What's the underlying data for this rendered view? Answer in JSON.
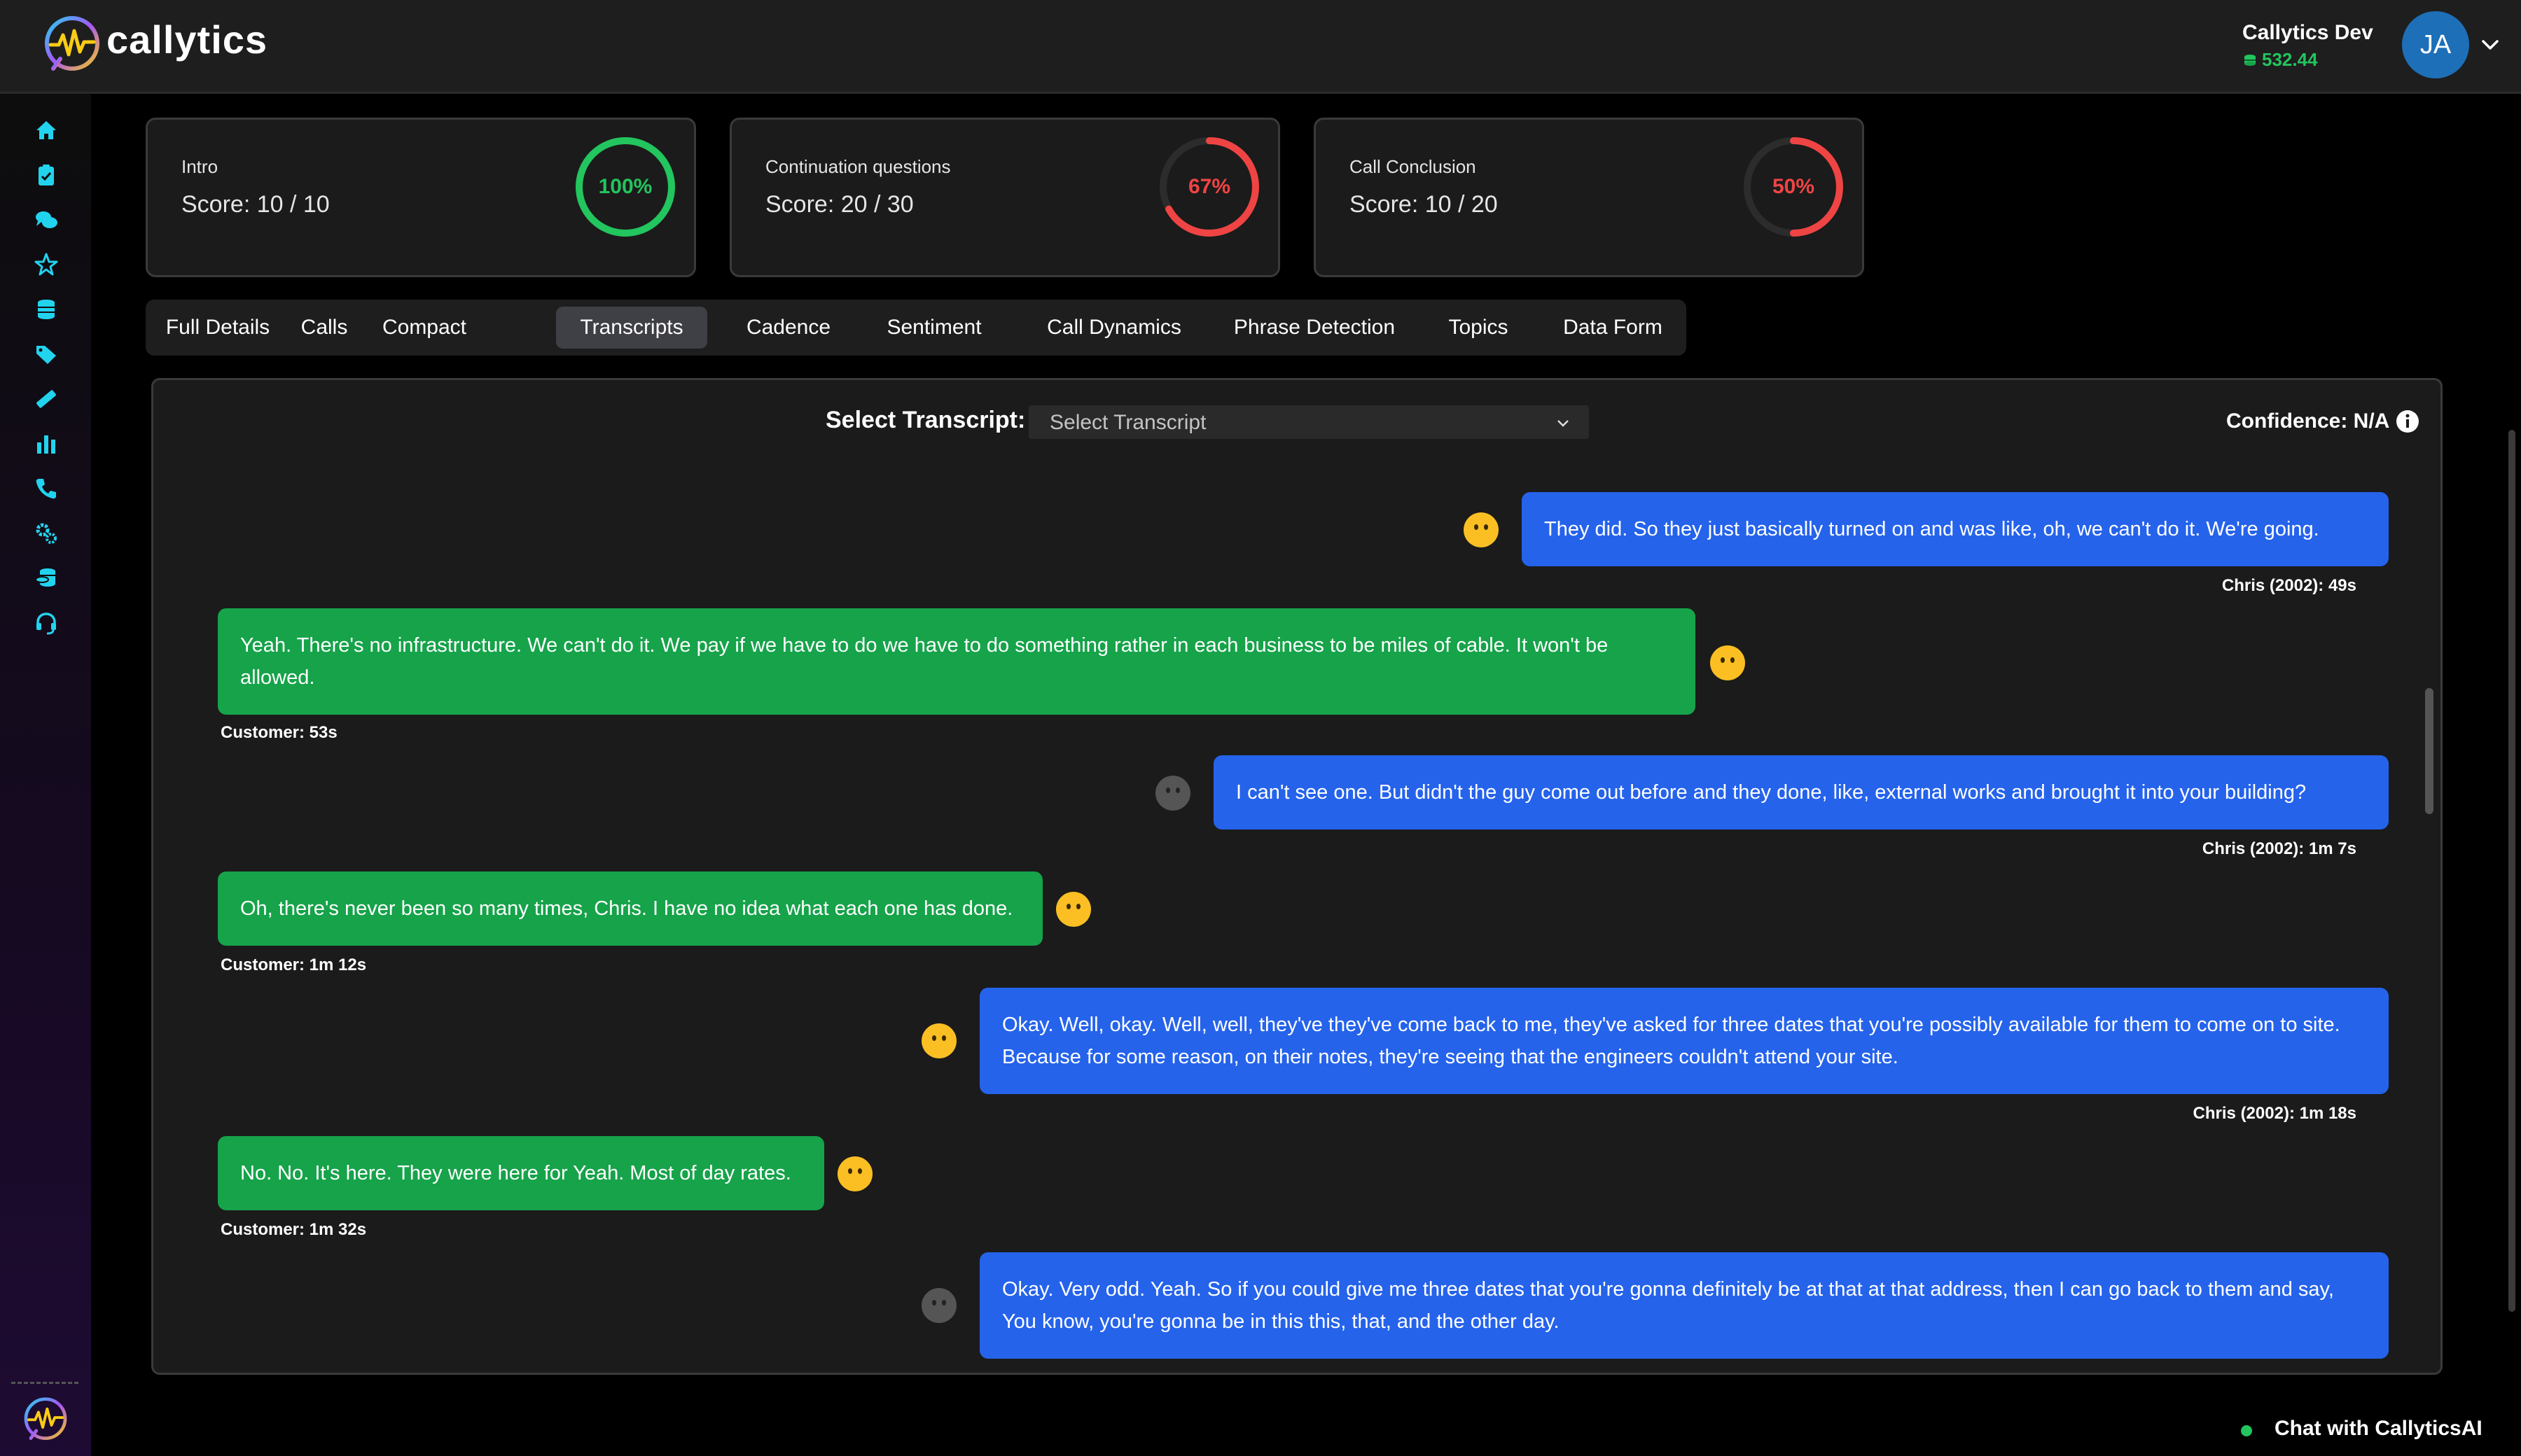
{
  "header": {
    "brand": "callytics",
    "user_name": "Callytics Dev",
    "credits": "532.44",
    "avatar_initials": "JA"
  },
  "sidebar": {
    "icons": [
      "home-icon",
      "clipboard-check-icon",
      "chat-bubbles-icon",
      "star-icon",
      "database-icon",
      "tags-icon",
      "ruler-icon",
      "bar-chart-icon",
      "phone-icon",
      "gears-icon",
      "coins-icon",
      "headset-icon"
    ]
  },
  "score_cards": [
    {
      "title": "Intro",
      "score": "Score: 10 / 10",
      "percent_label": "100%",
      "percent": 100,
      "color": "#22c55e"
    },
    {
      "title": "Continuation questions",
      "score": "Score: 20 / 30",
      "percent_label": "67%",
      "percent": 67,
      "color": "#ef4444"
    },
    {
      "title": "Call Conclusion",
      "score": "Score: 10 / 20",
      "percent_label": "50%",
      "percent": 50,
      "color": "#ef4444"
    }
  ],
  "tabs": [
    "Full Details",
    "Calls",
    "Compact",
    "Transcripts",
    "Cadence",
    "Sentiment",
    "Call Dynamics",
    "Phrase Detection",
    "Topics",
    "Data Form"
  ],
  "active_tab": "Transcripts",
  "transcript": {
    "select_label": "Select Transcript:",
    "select_placeholder": "Select Transcript",
    "confidence": "Confidence: N/A",
    "messages": [
      {
        "speaker": "agent",
        "text": "They did. So they just basically turned on and was like, oh, we can't do it. We're going.",
        "meta": "Chris (2002): 49s",
        "sentiment": "neutral"
      },
      {
        "speaker": "customer",
        "text": "Yeah. There's no infrastructure. We can't do it. We pay if we have to do we have to do something rather in each business to be miles of cable. It won't be allowed.",
        "meta": "Customer: 53s",
        "sentiment": "neutral"
      },
      {
        "speaker": "agent",
        "text": "I can't see one. But didn't the guy come out before and they done, like, external works and brought it into your building?",
        "meta": "Chris (2002): 1m 7s",
        "sentiment": "unknown"
      },
      {
        "speaker": "customer",
        "text": "Oh, there's never been so many times, Chris. I have no idea what each one has done.",
        "meta": "Customer: 1m 12s",
        "sentiment": "neutral"
      },
      {
        "speaker": "agent",
        "text": "Okay. Well, okay. Well, well, they've they've come back to me, they've asked for three dates that you're possibly available for them to come on to site. Because for some reason, on their notes, they're seeing that the engineers couldn't attend your site.",
        "meta": "Chris (2002): 1m 18s",
        "sentiment": "neutral"
      },
      {
        "speaker": "customer",
        "text": "No. No. It's here. They were here for Yeah. Most of day rates.",
        "meta": "Customer: 1m 32s",
        "sentiment": "neutral"
      },
      {
        "speaker": "agent",
        "text": "Okay. Very odd. Yeah. So if you could give me three dates that you're gonna definitely be at that at that address, then I can go back to them and say, You know, you're gonna be in this this, that, and the other day.",
        "meta": "",
        "sentiment": "unknown"
      }
    ]
  },
  "chat_widget": {
    "label": "Chat with CallyticsAI"
  },
  "colors": {
    "agent_bubble": "#2563eb",
    "customer_bubble": "#16a34a",
    "accent_cyan": "#22d3ee",
    "emoji_yellow": "#fbbf24"
  }
}
